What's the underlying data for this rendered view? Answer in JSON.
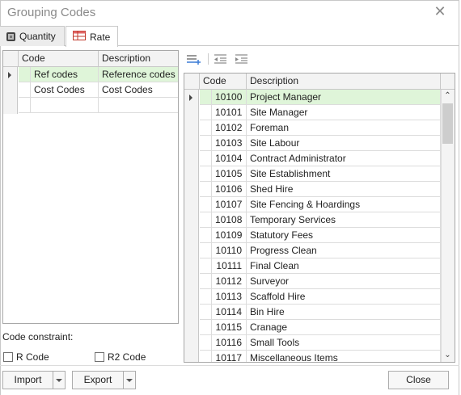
{
  "window": {
    "title": "Grouping Codes"
  },
  "tabs": [
    {
      "label": "Quantity"
    },
    {
      "label": "Rate"
    }
  ],
  "left_grid": {
    "columns": [
      "Code",
      "Description"
    ],
    "rows": [
      {
        "code": "Ref codes",
        "description": "Reference codes"
      },
      {
        "code": "Cost Codes",
        "description": "Cost Codes"
      }
    ]
  },
  "right_grid": {
    "columns": [
      "Code",
      "Description"
    ],
    "rows": [
      {
        "code": "10100",
        "description": "Project Manager"
      },
      {
        "code": "10101",
        "description": "Site Manager"
      },
      {
        "code": "10102",
        "description": "Foreman"
      },
      {
        "code": "10103",
        "description": "Site Labour"
      },
      {
        "code": "10104",
        "description": "Contract Administrator"
      },
      {
        "code": "10105",
        "description": "Site Establishment"
      },
      {
        "code": "10106",
        "description": "Shed Hire"
      },
      {
        "code": "10107",
        "description": "Site Fencing & Hoardings"
      },
      {
        "code": "10108",
        "description": "Temporary Services"
      },
      {
        "code": "10109",
        "description": "Statutory Fees"
      },
      {
        "code": "10110",
        "description": "Progress Clean"
      },
      {
        "code": "10111",
        "description": "Final Clean"
      },
      {
        "code": "10112",
        "description": "Surveyor"
      },
      {
        "code": "10113",
        "description": "Scaffold Hire"
      },
      {
        "code": "10114",
        "description": "Bin Hire"
      },
      {
        "code": "10115",
        "description": "Cranage"
      },
      {
        "code": "10116",
        "description": "Small Tools"
      },
      {
        "code": "10117",
        "description": "Miscellaneous Items"
      }
    ]
  },
  "constraint": {
    "label": "Code constraint:",
    "r_code": "R Code",
    "r2_code": "R2 Code"
  },
  "buttons": {
    "import": "Import",
    "export": "Export",
    "close": "Close"
  },
  "icons": {
    "close": "close-icon",
    "quantity_tab": "quantity-icon",
    "rate_tab": "rate-table-icon",
    "toolbar": [
      "insert-row-icon",
      "outdent-icon",
      "indent-icon"
    ]
  }
}
